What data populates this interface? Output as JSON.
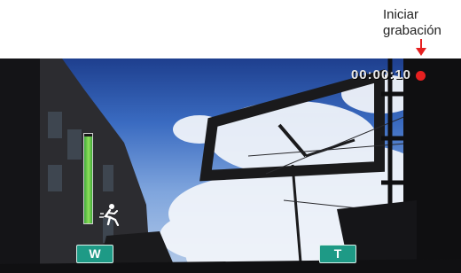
{
  "callout": {
    "line1": "Iniciar",
    "line2": "grabación",
    "arrow_color": "#e62020"
  },
  "viewfinder": {
    "recording_time": "00:00:10",
    "recording_indicator_color": "#e62020",
    "zoom_level": 0.97,
    "mode_icon": "sports-mode-icon",
    "zoom_wide_label": "W",
    "zoom_tele_label": "T"
  }
}
